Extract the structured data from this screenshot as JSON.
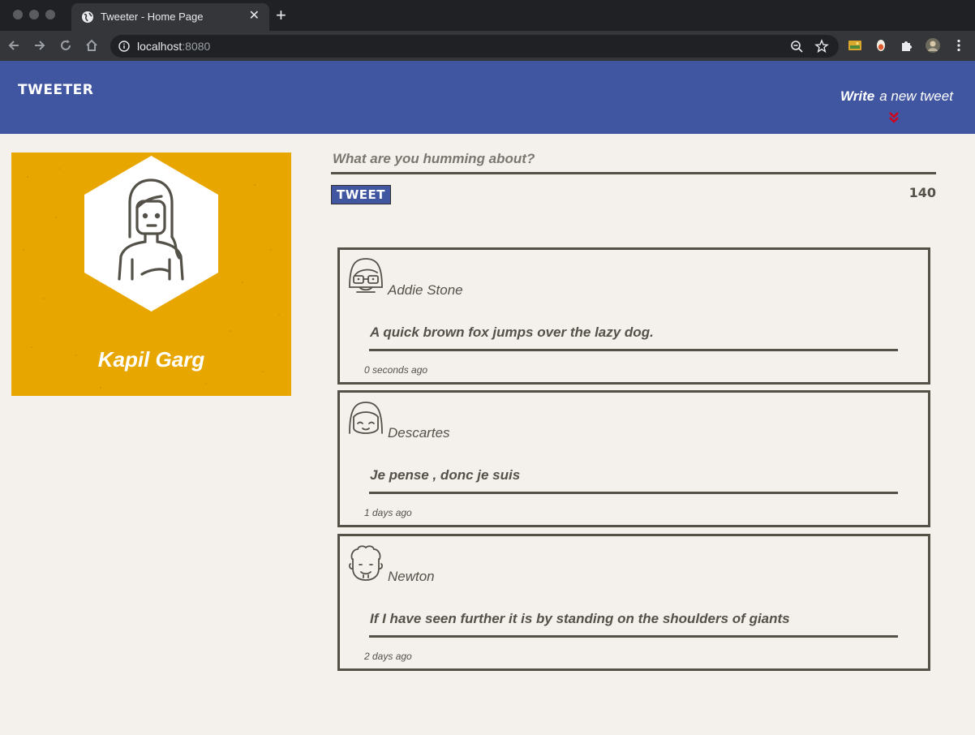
{
  "browser": {
    "tab_title": "Tweeter - Home Page",
    "tab_close": "✕",
    "new_tab": "+",
    "url_host": "localhost",
    "url_port": ":8080"
  },
  "header": {
    "logo": "TWEETER",
    "compose_bold": "Write",
    "compose_rest": "a new tweet",
    "chevron_color": "#d4001a"
  },
  "profile": {
    "name": "Kapil Garg",
    "bg_color": "#e8a700"
  },
  "composer": {
    "placeholder": "What are you humming about?",
    "button_label": "TWEET",
    "counter": "140"
  },
  "tweets": [
    {
      "author": "Addie Stone",
      "content": "A quick brown fox jumps over the lazy dog.",
      "time": "0 seconds ago",
      "avatar": "girl-glasses-avatar-icon"
    },
    {
      "author": "Descartes",
      "content": "Je pense , donc je suis",
      "time": "1 days ago",
      "avatar": "girl-smiling-avatar-icon"
    },
    {
      "author": "Newton",
      "content": "If I have seen further it is by standing on the shoulders of giants",
      "time": "2 days ago",
      "avatar": "curly-hair-avatar-icon"
    }
  ],
  "colors": {
    "header_bg": "#4056a1",
    "page_bg": "#f4f1ed",
    "text": "#545149"
  }
}
